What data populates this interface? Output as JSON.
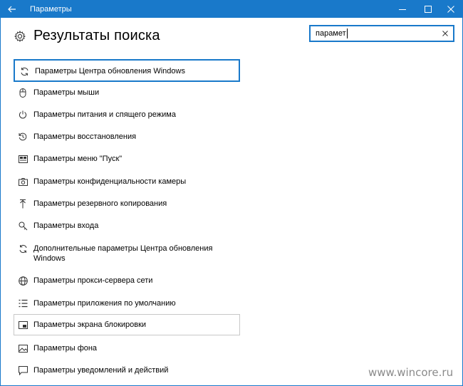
{
  "window": {
    "title": "Параметры"
  },
  "page": {
    "heading": "Результаты поиска"
  },
  "search": {
    "value": "парамет"
  },
  "results": [
    {
      "label": "Параметры Центра обновления Windows",
      "icon": "sync-icon"
    },
    {
      "label": "Параметры мыши",
      "icon": "mouse-icon"
    },
    {
      "label": "Параметры питания и спящего режима",
      "icon": "power-icon"
    },
    {
      "label": "Параметры восстановления",
      "icon": "history-icon"
    },
    {
      "label": "Параметры меню \"Пуск\"",
      "icon": "start-menu-icon"
    },
    {
      "label": "Параметры конфиденциальности камеры",
      "icon": "camera-icon"
    },
    {
      "label": "Параметры резервного копирования",
      "icon": "upload-icon"
    },
    {
      "label": "Параметры входа",
      "icon": "key-icon"
    },
    {
      "label": "Дополнительные параметры Центра обновления",
      "label_line2": "Windows",
      "icon": "sync-icon"
    },
    {
      "label": "Параметры прокси-сервера сети",
      "icon": "globe-icon"
    },
    {
      "label": "Параметры приложения по умолчанию",
      "icon": "list-icon"
    },
    {
      "label": "Параметры экрана блокировки",
      "icon": "lock-screen-icon"
    },
    {
      "label": "Параметры фона",
      "icon": "picture-icon"
    },
    {
      "label": "Параметры уведомлений и действий",
      "icon": "message-icon"
    }
  ],
  "watermark": "www.wincore.ru",
  "colors": {
    "accent": "#1979ca",
    "hover_border": "#c8c8c8"
  }
}
